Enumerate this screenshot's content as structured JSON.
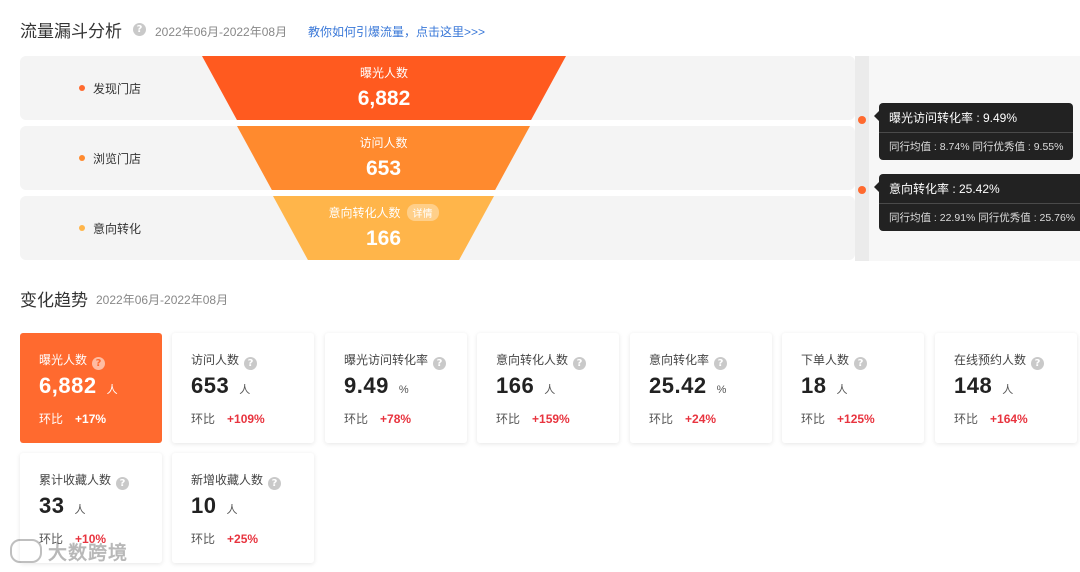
{
  "funnel_section": {
    "title": "流量漏斗分析",
    "date_range": "2022年06月-2022年08月",
    "help_link": "教你如何引爆流量，点击这里>>>",
    "stages": [
      {
        "label": "发现门店",
        "metric": "曝光人数",
        "value": "6,882",
        "color": "#ff5a1f",
        "dot_color": "#ff6a2f"
      },
      {
        "label": "浏览门店",
        "metric": "访问人数",
        "value": "653",
        "color": "#ff8a2e",
        "dot_color": "#ff8a2e"
      },
      {
        "label": "意向转化",
        "metric": "意向转化人数",
        "value": "166",
        "color": "#ffb54a",
        "dot_color": "#ffb54a",
        "detail_label": "详情"
      }
    ],
    "tooltips": [
      {
        "main": "曝光访问转化率 : 9.49%",
        "sub": "同行均值 : 8.74%   同行优秀值 : 9.55%"
      },
      {
        "main": "意向转化率 : 25.42%",
        "sub": "同行均值 : 22.91%   同行优秀值 : 25.76%"
      }
    ]
  },
  "trend_section": {
    "title": "变化趋势",
    "date_range": "2022年06月-2022年08月",
    "compare_label": "环比",
    "cards": [
      {
        "name": "曝光人数",
        "value": "6,882",
        "unit": "人",
        "change": "+17%",
        "active": true
      },
      {
        "name": "访问人数",
        "value": "653",
        "unit": "人",
        "change": "+109%"
      },
      {
        "name": "曝光访问转化率",
        "value": "9.49",
        "unit": "%",
        "change": "+78%"
      },
      {
        "name": "意向转化人数",
        "value": "166",
        "unit": "人",
        "change": "+159%"
      },
      {
        "name": "意向转化率",
        "value": "25.42",
        "unit": "%",
        "change": "+24%"
      },
      {
        "name": "下单人数",
        "value": "18",
        "unit": "人",
        "change": "+125%"
      },
      {
        "name": "在线预约人数",
        "value": "148",
        "unit": "人",
        "change": "+164%"
      },
      {
        "name": "累计收藏人数",
        "value": "33",
        "unit": "人",
        "change": "+10%"
      },
      {
        "name": "新增收藏人数",
        "value": "10",
        "unit": "人",
        "change": "+25%"
      }
    ]
  },
  "help_glyph": "?",
  "watermark": "大数跨境",
  "colors": {
    "accent": "#ff6a2f",
    "positive_change": "#e8343f",
    "link": "#3a78d8"
  }
}
